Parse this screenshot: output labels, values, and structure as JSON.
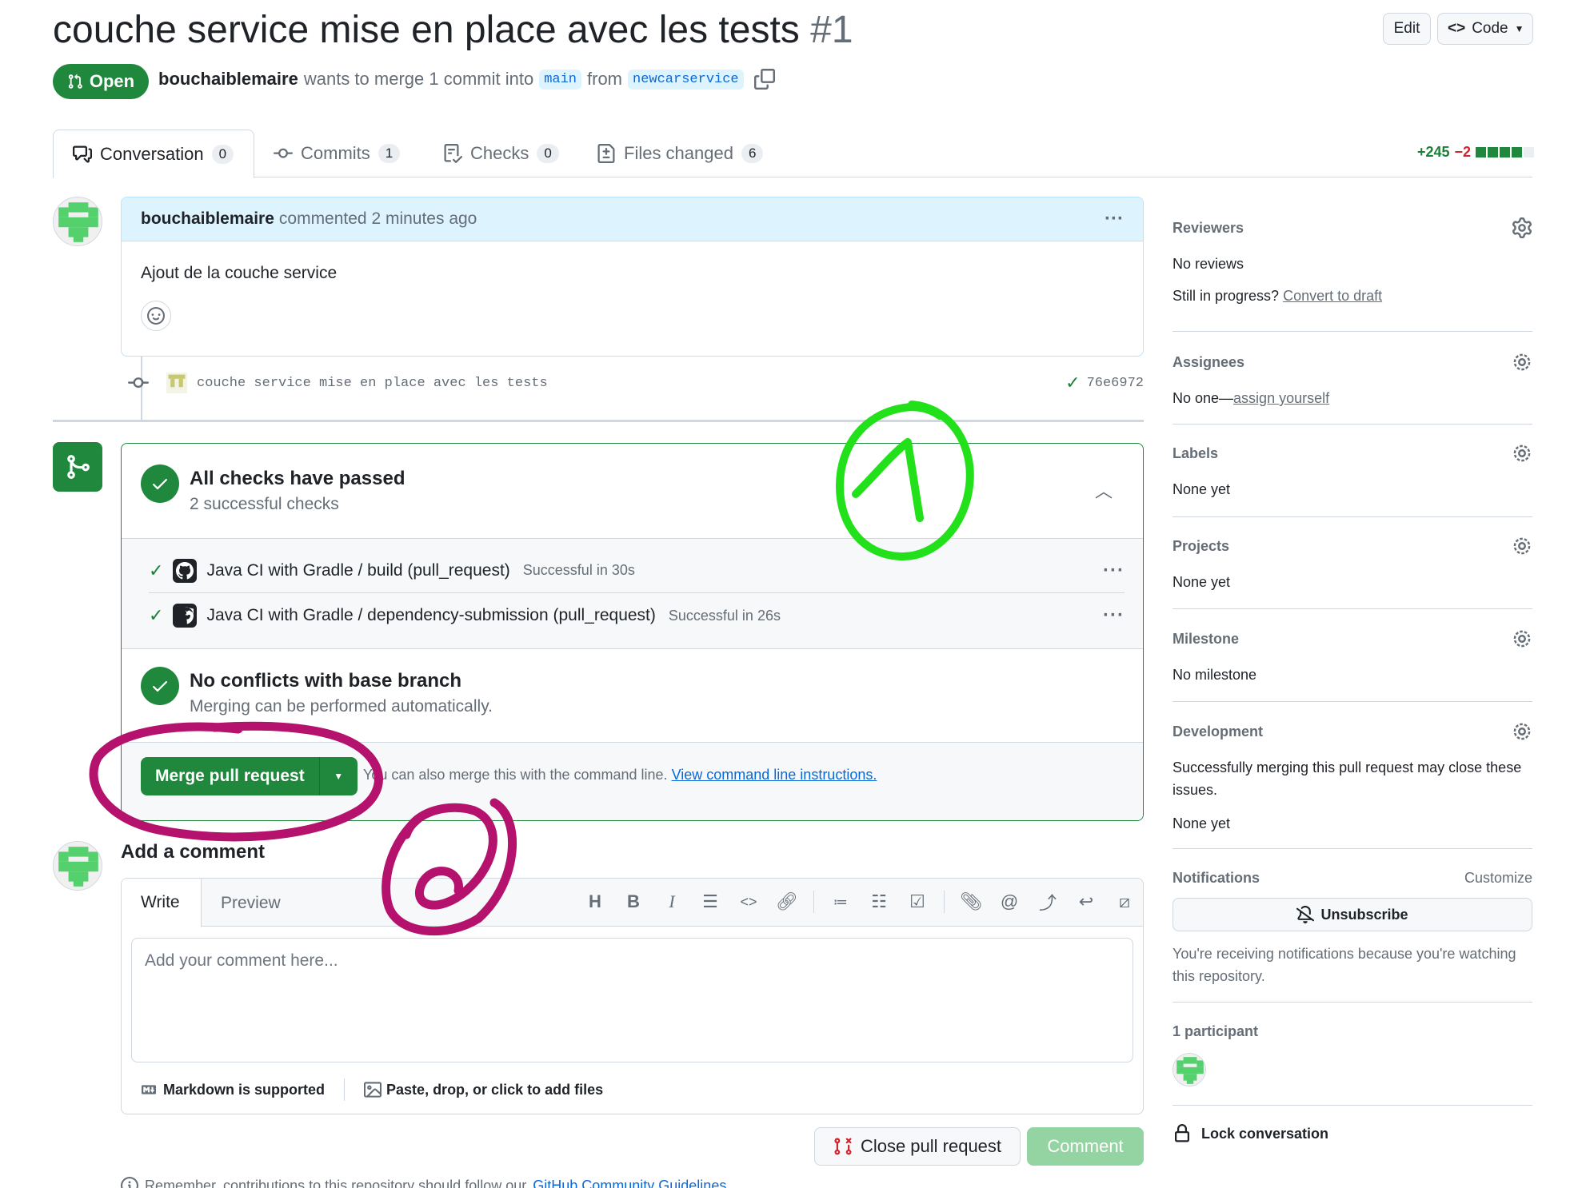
{
  "header": {
    "title": "couche service mise en place avec les tests",
    "number": "#1",
    "edit_label": "Edit",
    "code_label": "Code",
    "state": "Open",
    "author": "bouchaiblemaire",
    "merge_text": "wants to merge 1 commit into",
    "base_branch": "main",
    "from_text": "from",
    "head_branch": "newcarservice"
  },
  "tabs": [
    {
      "label": "Conversation",
      "count": "0"
    },
    {
      "label": "Commits",
      "count": "1"
    },
    {
      "label": "Checks",
      "count": "0"
    },
    {
      "label": "Files changed",
      "count": "6"
    }
  ],
  "diffstat": {
    "additions": "+245",
    "deletions": "−2"
  },
  "comment": {
    "author": "bouchaiblemaire",
    "meta": "commented 2 minutes ago",
    "body": "Ajout de la couche service"
  },
  "commit": {
    "message": "couche service mise en place avec les tests",
    "sha": "76e6972"
  },
  "checks": {
    "title": "All checks have passed",
    "subtitle": "2 successful checks",
    "rows": [
      {
        "name": "Java CI with Gradle / build (pull_request)",
        "status": "Successful in 30s"
      },
      {
        "name": "Java CI with Gradle / dependency-submission (pull_request)",
        "status": "Successful in 26s"
      }
    ]
  },
  "conflicts": {
    "title": "No conflicts with base branch",
    "subtitle": "Merging can be performed automatically."
  },
  "merge": {
    "button_label": "Merge pull request",
    "help_text": "You can also merge this with the command line.",
    "help_link": "View command line instructions."
  },
  "add_comment": {
    "title": "Add a comment",
    "write_tab": "Write",
    "preview_tab": "Preview",
    "placeholder": "Add your comment here...",
    "markdown_note": "Markdown is supported",
    "files_note": "Paste, drop, or click to add files",
    "close_label": "Close pull request",
    "comment_label": "Comment"
  },
  "guidelines": {
    "text": "Remember, contributions to this repository should follow our",
    "link": "GitHub Community Guidelines",
    "end": "."
  },
  "sidebar": {
    "reviewers": {
      "title": "Reviewers",
      "value": "No reviews",
      "progress_text": "Still in progress?",
      "progress_link": "Convert to draft"
    },
    "assignees": {
      "title": "Assignees",
      "value": "No one—",
      "link": "assign yourself"
    },
    "labels": {
      "title": "Labels",
      "value": "None yet"
    },
    "projects": {
      "title": "Projects",
      "value": "None yet"
    },
    "milestone": {
      "title": "Milestone",
      "value": "No milestone"
    },
    "development": {
      "title": "Development",
      "text": "Successfully merging this pull request may close these issues.",
      "value": "None yet"
    },
    "notifications": {
      "title": "Notifications",
      "customize": "Customize",
      "button": "Unsubscribe",
      "text": "You're receiving notifications because you're watching this repository."
    },
    "participants": {
      "title": "1 participant"
    },
    "lock": {
      "label": "Lock conversation"
    }
  },
  "colors": {
    "success": "#1f883d",
    "link": "#0969da",
    "annotation_1": "#22e01a",
    "annotation_2": "#b5126e"
  }
}
